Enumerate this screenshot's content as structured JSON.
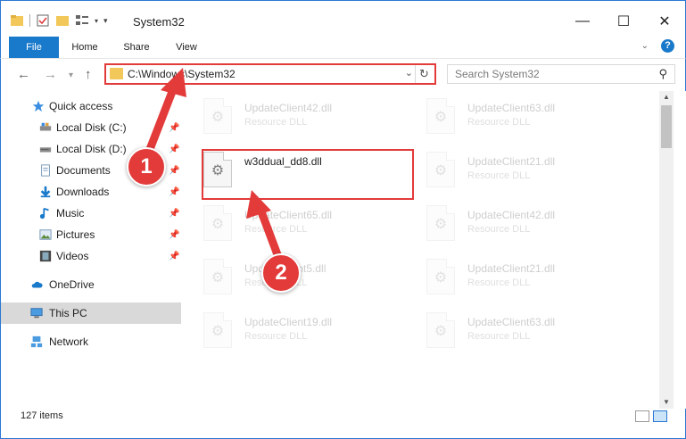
{
  "window": {
    "title": "System32",
    "minimize_glyph": "—",
    "maximize_glyph": "☐",
    "close_glyph": "✕"
  },
  "ribbon": {
    "tabs": [
      {
        "label": "File"
      },
      {
        "label": "Home"
      },
      {
        "label": "Share"
      },
      {
        "label": "View"
      }
    ],
    "help_label": "?"
  },
  "navigation": {
    "address_path": "C:\\Windows\\System32",
    "search_placeholder": "Search System32"
  },
  "sidebar": {
    "quick_access": {
      "label": "Quick access",
      "icon": "star-icon"
    },
    "items": [
      {
        "label": "Local Disk (C:)",
        "icon": "drive-icon",
        "pinned": true
      },
      {
        "label": "Local Disk (D:)",
        "icon": "drive-icon",
        "pinned": true
      },
      {
        "label": "Documents",
        "icon": "documents-icon",
        "pinned": true
      },
      {
        "label": "Downloads",
        "icon": "downloads-icon",
        "pinned": true
      },
      {
        "label": "Music",
        "icon": "music-icon",
        "pinned": true
      },
      {
        "label": "Pictures",
        "icon": "pictures-icon",
        "pinned": true
      },
      {
        "label": "Videos",
        "icon": "videos-icon",
        "pinned": true
      }
    ],
    "onedrive": {
      "label": "OneDrive",
      "icon": "cloud-icon"
    },
    "this_pc": {
      "label": "This PC",
      "icon": "computer-icon",
      "selected": true
    },
    "network": {
      "label": "Network",
      "icon": "network-icon"
    }
  },
  "files": [
    {
      "name": "UpdateClient42.dll",
      "type": "Resource DLL",
      "faded": true
    },
    {
      "name": "UpdateClient63.dll",
      "type": "Resource DLL",
      "faded": true
    },
    {
      "name": "w3ddual_dd8.dll",
      "type": "",
      "faded": false,
      "highlighted": true
    },
    {
      "name": "UpdateClient21.dll",
      "type": "Resource DLL",
      "faded": true
    },
    {
      "name": "UpdateClient65.dll",
      "type": "Resource DLL",
      "faded": true
    },
    {
      "name": "UpdateClient42.dll",
      "type": "Resource DLL",
      "faded": true
    },
    {
      "name": "UpdateClient5.dll",
      "type": "Resource DLL",
      "faded": true
    },
    {
      "name": "UpdateClient21.dll",
      "type": "Resource DLL",
      "faded": true
    },
    {
      "name": "UpdateClient19.dll",
      "type": "Resource DLL",
      "faded": true
    },
    {
      "name": "UpdateClient63.dll",
      "type": "Resource DLL",
      "faded": true
    }
  ],
  "status": {
    "item_count": "127 items"
  },
  "annotations": {
    "step1": "1",
    "step2": "2",
    "color": "#e33a3a"
  },
  "colors": {
    "accent": "#1979ca",
    "window_border": "#2b78d4",
    "annotation_red": "#e33a3a",
    "selected_bg": "#d9d9d9"
  }
}
